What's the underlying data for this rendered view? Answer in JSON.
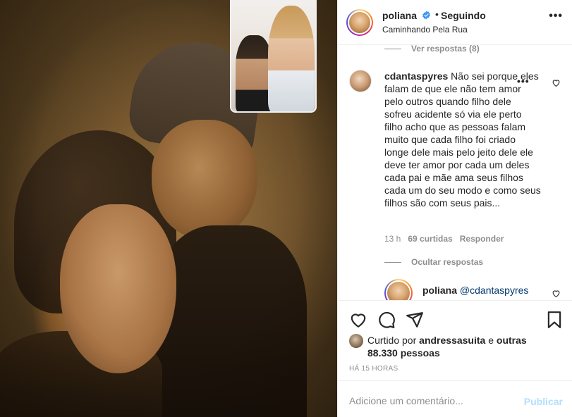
{
  "post": {
    "username": "poliana",
    "follow_status": "Seguindo",
    "separator": "•",
    "location": "Caminhando Pela Rua",
    "more_label": "•••"
  },
  "comments": {
    "view_replies": "Ver respostas (8)",
    "main": {
      "username": "cdantaspyres",
      "text": "Não sei porque eles falam de que ele não tem amor pelo outros quando filho dele sofreu acidente só via ele perto filho acho que as pessoas falam muito que cada filho foi criado longe dele mais pelo jeito dele ele deve ter amor por cada um deles cada pai e mãe ama seus filhos cada um do seu modo e como seus filhos são com seus pais...",
      "time": "13 h",
      "likes": "69 curtidas",
      "reply_label": "Responder",
      "more_label": "•••"
    },
    "hide_replies": "Ocultar respostas",
    "reply": {
      "username": "poliana",
      "mention": "@cdantaspyres"
    }
  },
  "actions": {
    "like_icon": "heart-outline-icon",
    "comment_icon": "comment-bubble-icon",
    "share_icon": "paper-plane-icon",
    "save_icon": "bookmark-icon"
  },
  "likes": {
    "prefix": "Curtido por",
    "user": "andressasuita",
    "middle": "e",
    "others": "outras 88.330 pessoas"
  },
  "timestamp": "HÁ 15 HORAS",
  "add_comment": {
    "placeholder": "Adicione um comentário...",
    "submit_label": "Publicar"
  },
  "colors": {
    "text": "#262626",
    "muted": "#8e8e8e",
    "verified": "#3897f0",
    "publish_disabled": "#b2dffc",
    "mention": "#00376b"
  }
}
